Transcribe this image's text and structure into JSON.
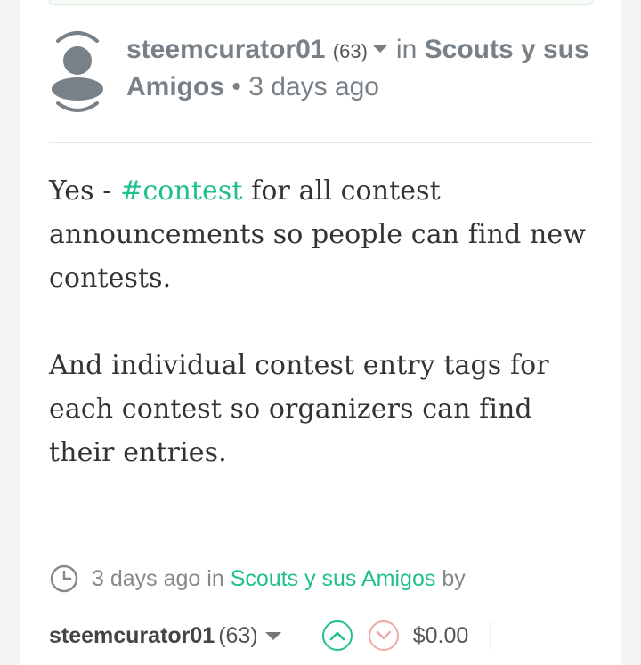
{
  "post_header": {
    "author": "steemcurator01",
    "reputation": "(63)",
    "in_label": "in",
    "community_line1": "Scouts y sus",
    "community_line2": "Amigos",
    "bullet": "•",
    "time_ago": "3 days ago"
  },
  "body": {
    "p1_before": "Yes - ",
    "p1_tag": "#contest",
    "p1_after": " for all contest announcements so people can find new contests.",
    "p2": "And individual contest entry tags for each contest so organizers can find their entries."
  },
  "meta": {
    "time": "3 days ago",
    "in_label": "in",
    "community": "Scouts y sus Amigos",
    "by_label": "by"
  },
  "footer": {
    "author": "steemcurator01",
    "reputation": "(63)",
    "payout": "$0.00"
  },
  "colors": {
    "accent": "#1fbf8f",
    "downvote": "#f2a7a7",
    "muted": "#788187"
  }
}
